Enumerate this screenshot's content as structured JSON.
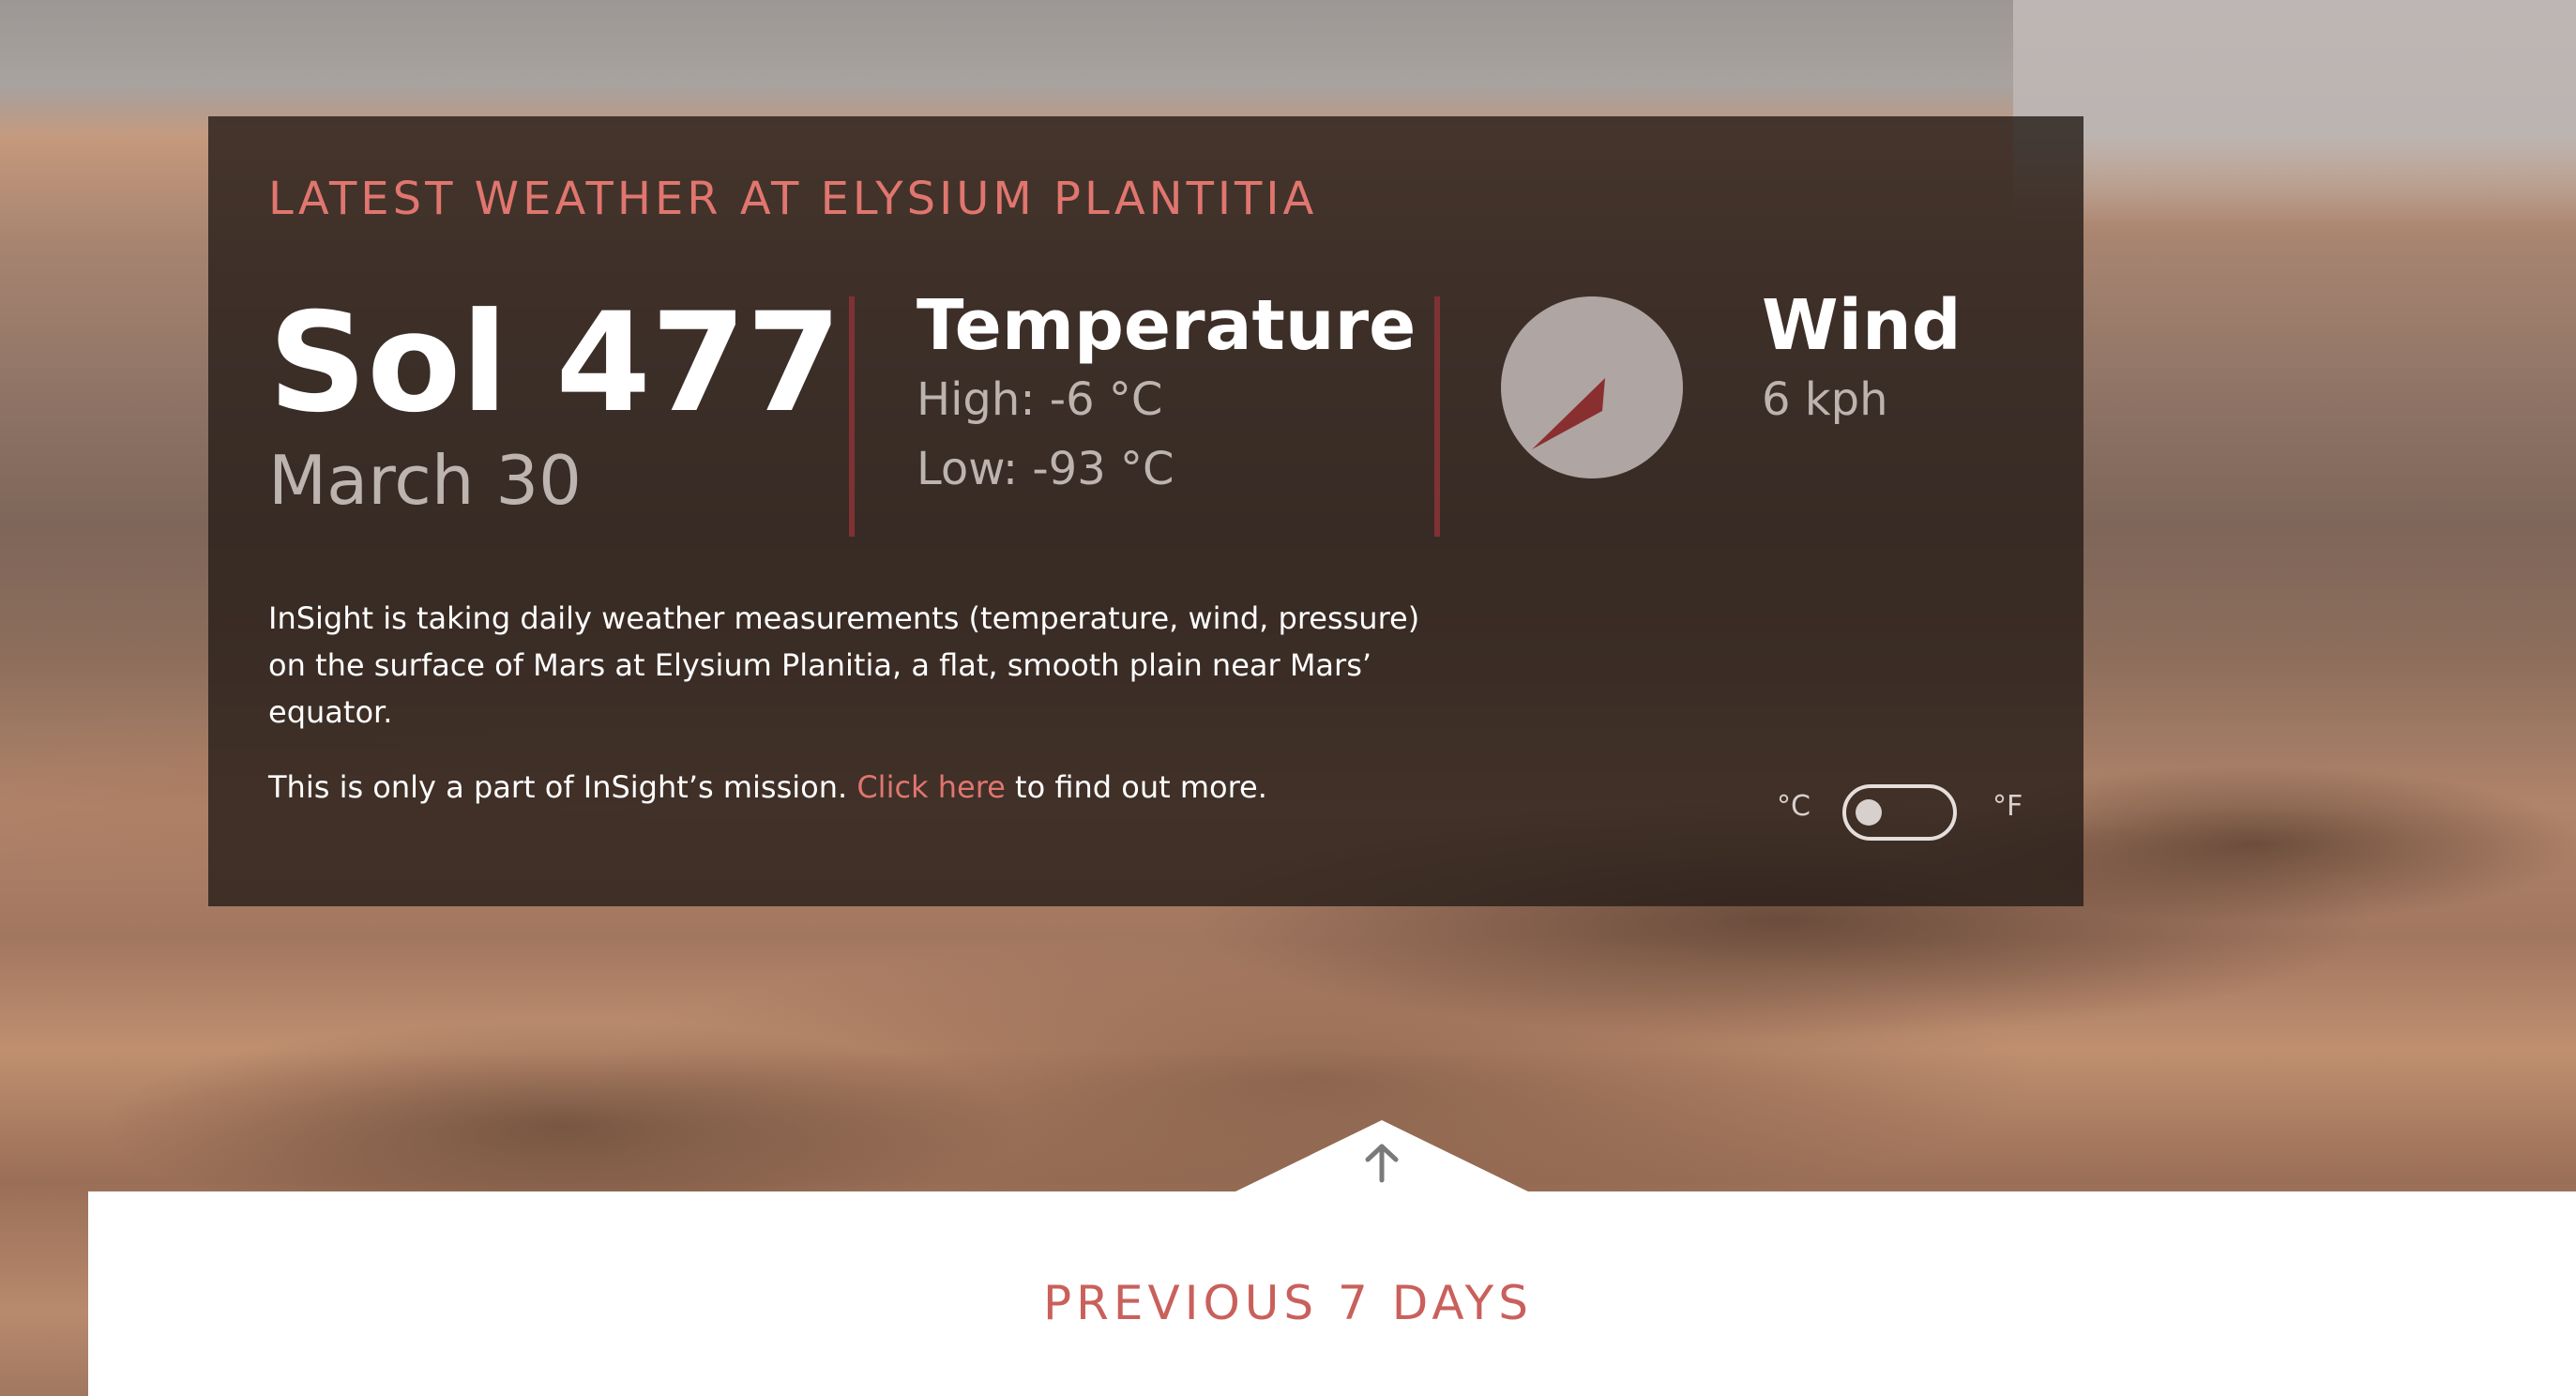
{
  "current": {
    "heading": "LATEST WEATHER AT ELYSIUM PLANTITIA",
    "sol": "Sol 477",
    "date": "March 30",
    "temperature": {
      "title": "Temperature",
      "high": "High: -6 °C",
      "low": "Low: -93 °C"
    },
    "wind": {
      "title": "Wind",
      "speed": "6 kph",
      "direction_icon": "compass-arrow-icon"
    }
  },
  "info": {
    "description": "InSight is taking daily weather measurements (temperature, wind, pressure) on the surface of Mars at Elysium Planitia, a flat, smooth plain near Mars’ equator.",
    "mission_prefix": "This is only a part of InSight’s mission. ",
    "mission_link": "Click here",
    "mission_suffix": " to find out more."
  },
  "unit_toggle": {
    "celsius_label": "°C",
    "fahrenheit_label": "°F",
    "selected": "°C"
  },
  "previous": {
    "heading": "PREVIOUS 7 DAYS",
    "toggle_icon": "arrow-up-icon"
  },
  "colors": {
    "accent": "#e0766f",
    "divider": "#7f3233",
    "panel_bg": "rgba(40,30,26,0.82)"
  }
}
